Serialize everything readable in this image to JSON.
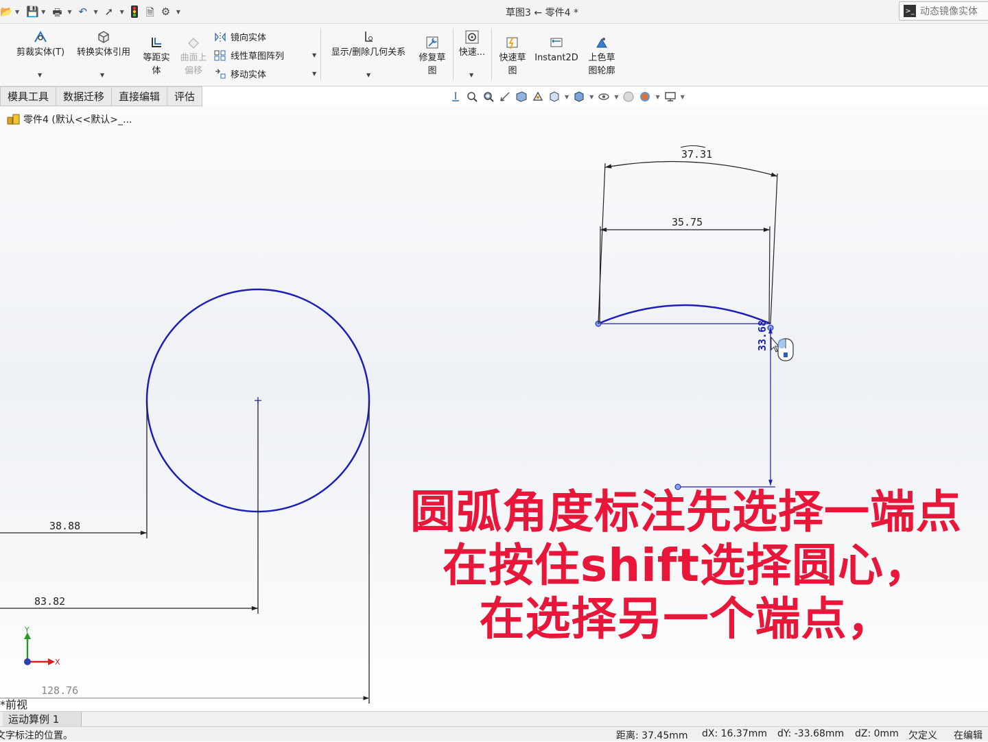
{
  "window": {
    "title": "草图3 ← 零件4 *",
    "command_search": "动态镜像实体"
  },
  "quick_access": {
    "icons": [
      "open-icon",
      "save-icon",
      "print-icon",
      "undo-icon",
      "select-icon",
      "traffic-light-icon",
      "file-properties-icon",
      "options-gear-icon"
    ]
  },
  "ribbon": {
    "trim_entities": "剪裁实体(T)",
    "convert_entities": "转换实体引用",
    "offset_entities_1": "等距实",
    "offset_entities_2": "体",
    "surface_offset_1": "曲面上",
    "surface_offset_2": "偏移",
    "mirror_entities": "镜向实体",
    "linear_pattern": "线性草图阵列",
    "move_entities": "移动实体",
    "display_relations": "显示/删除几何关系",
    "repair_sketch_1": "修复草",
    "repair_sketch_2": "图",
    "quick_snaps": "快速...",
    "rapid_sketch_1": "快速草",
    "rapid_sketch_2": "图",
    "instant2d": "Instant2D",
    "shaded_contours_1": "上色草",
    "shaded_contours_2": "图轮廓"
  },
  "tabs": [
    "模具工具",
    "数据迁移",
    "直接编辑",
    "评估"
  ],
  "feature_tree": {
    "part_label": "零件4 (默认<<默认>_..."
  },
  "dimensions": {
    "arc_length": "37.31",
    "chord": "35.75",
    "vertical": "33.68",
    "circle_left": "38.88",
    "circle_center": "83.82",
    "right_edge": "128.76"
  },
  "triad": {
    "y": "Y",
    "x": "X"
  },
  "caption": {
    "line1": "圆弧角度标注先选择一端点",
    "line2": "在按住shift选择圆心，",
    "line3": "在选择另一个端点，"
  },
  "view_name": "*前视",
  "bottom_tabs": {
    "motion_study": "运动算例 1"
  },
  "status": {
    "hint": "文字标注的位置。",
    "distance": "距离: 37.45mm",
    "dx": "dX: 16.37mm",
    "dy": "dY: -33.68mm",
    "dz": "dZ: 0mm",
    "defined": "欠定义",
    "editing": "在编辑"
  },
  "colors": {
    "sketch_blue": "#1d1db8",
    "caption_red": "#e8173a",
    "dimension_black": "#222222"
  }
}
